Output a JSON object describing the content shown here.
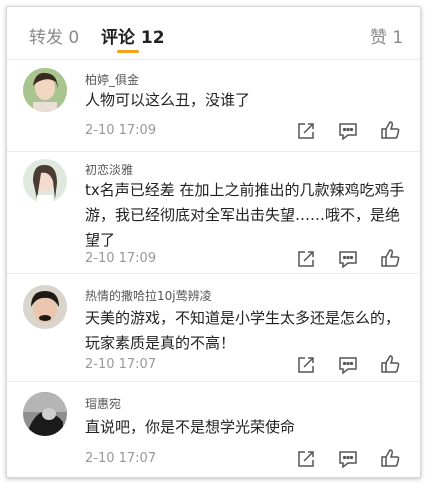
{
  "tabs": {
    "repost_label": "转发",
    "repost_count": "0",
    "comments_label": "评论",
    "comments_count": "12",
    "likes_label": "赞",
    "likes_count": "1"
  },
  "accent_color": "#f7a21b",
  "action_icons": [
    "share-icon",
    "reply-icon",
    "like-icon"
  ],
  "comments": [
    {
      "user": "柏婷_俱金",
      "text": "人物可以这么丑，没谁了",
      "time": "2-10 17:09"
    },
    {
      "user": "初恋淡雅",
      "text": "tx名声已经差 在加上之前推出的几款辣鸡吃鸡手游，我已经彻底对全军出击失望……哦不，是绝望了",
      "time": "2-10 17:09"
    },
    {
      "user": "热情的撒哈拉10j莺辨凌",
      "text": "天美的游戏，不知道是小学生太多还是怎么的，玩家素质是真的不高！",
      "time": "2-10 17:07"
    },
    {
      "user": "瑁惠宛",
      "text": "直说吧，你是不是想学光荣使命",
      "time": "2-10 17:07"
    }
  ]
}
